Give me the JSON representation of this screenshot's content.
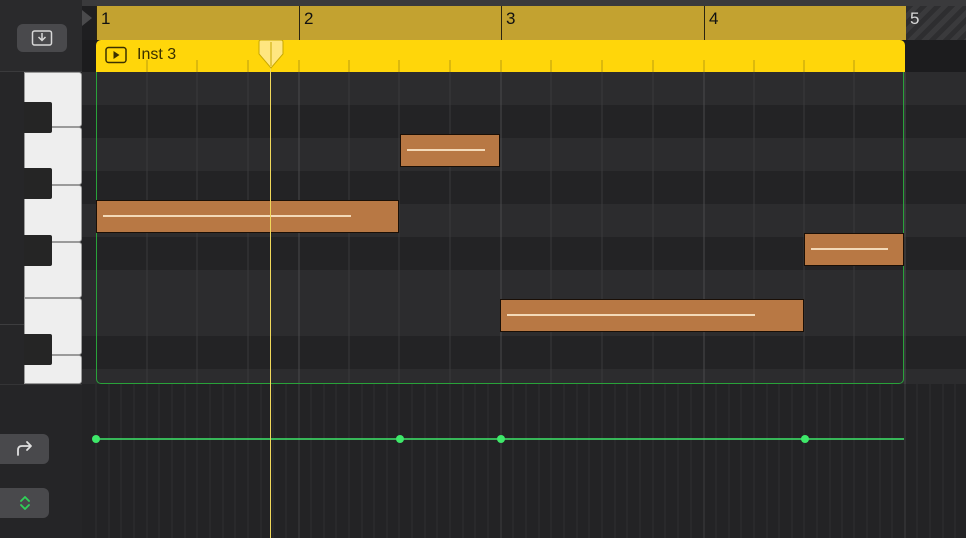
{
  "ruler": {
    "bars": [
      "1",
      "2",
      "3",
      "4",
      "5"
    ]
  },
  "region": {
    "name": "Inst 3",
    "color": "#ffd60a",
    "icon": "play-icon"
  },
  "notes_color": "#b87844",
  "automation_color": "#3ee86a",
  "left_panel": {
    "catch_icon": "import-icon",
    "redo_icon": "redo-arrow-icon",
    "stepper_icon": "stepper-icon"
  },
  "playhead_color": "#f0d85a"
}
